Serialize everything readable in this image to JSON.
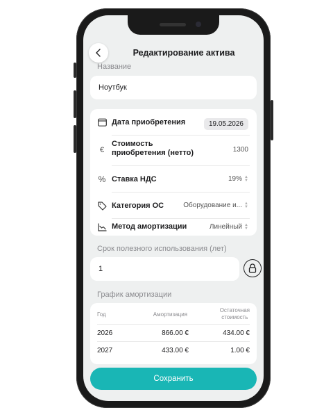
{
  "header": {
    "title": "Редактирование актива"
  },
  "name_field": {
    "label": "Название",
    "value": "Ноутбук"
  },
  "details": {
    "purchase_date": {
      "label": "Дата приобретения",
      "value": "19.05.2026",
      "icon": "calendar-icon"
    },
    "cost": {
      "label_line1": "Стоимость",
      "label_line2": "приобретения (нетто)",
      "value": "1300",
      "icon": "euro-icon"
    },
    "vat": {
      "label": "Ставка НДС",
      "value": "19%",
      "icon": "percent-icon"
    },
    "category": {
      "label": "Категория ОС",
      "value": "Оборудование и...",
      "icon": "tag-icon"
    },
    "method": {
      "label": "Метод амортизации",
      "value": "Линейный",
      "icon": "chart-icon"
    }
  },
  "useful_life": {
    "label": "Срок полезного использования (лет)",
    "value": "1"
  },
  "schedule": {
    "label": "График амортизации",
    "columns": [
      "Год",
      "Амортизация",
      "Остаточная",
      "стоимость"
    ],
    "rows": [
      {
        "year": "2026",
        "depreciation": "866.00 €",
        "residual": "434.00 €"
      },
      {
        "year": "2027",
        "depreciation": "433.00 €",
        "residual": "1.00 €"
      }
    ]
  },
  "save_button": {
    "label": "Сохранить"
  },
  "colors": {
    "accent": "#19b6b5",
    "background": "#eef0f0"
  }
}
